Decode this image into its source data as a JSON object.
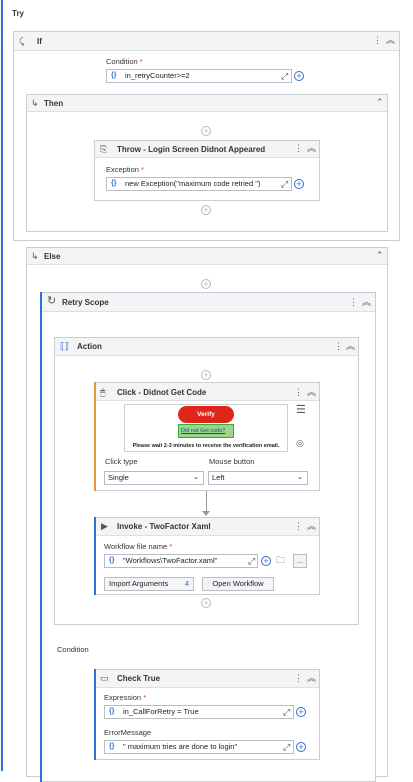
{
  "try_label": "Try",
  "if_block": {
    "title": "If",
    "condition_label": "Condition",
    "condition_value": "in_retryCounter>=2",
    "then_label": "Then",
    "throw": {
      "title": "Throw - Login Screen Didnot Appeared",
      "exception_label": "Exception",
      "exception_value": "new Exception(\"maximum code retried \")"
    },
    "else_label": "Else"
  },
  "retry_scope": {
    "title": "Retry Scope",
    "action_label": "Action",
    "click": {
      "title": "Click - Didnot Get Code",
      "preview_button": "Verify",
      "preview_link": "Did not Get code?",
      "preview_caption": "Please wait 2-3 minutes to receive the verification email.",
      "click_type_label": "Click type",
      "click_type_value": "Single",
      "mouse_button_label": "Mouse button",
      "mouse_button_value": "Left"
    },
    "invoke": {
      "title": "Invoke - TwoFactor Xaml",
      "file_label": "Workflow file name",
      "file_value": "\"Workflows\\TwoFactor.xaml\"",
      "import_label": "Import Arguments",
      "import_count": "4",
      "open_label": "Open Workflow",
      "more_label": "..."
    },
    "condition_label": "Condition",
    "check_true": {
      "title": "Check True",
      "expression_label": "Expression",
      "expression_value": "in_CallForRetry = True",
      "error_label": "ErrorMessage",
      "error_value": "\" maximum tries are done to login\""
    }
  },
  "colors": {
    "accent": "#2f6fcf",
    "verify_red": "#e0251b",
    "link_green": "#7fcf6f"
  }
}
